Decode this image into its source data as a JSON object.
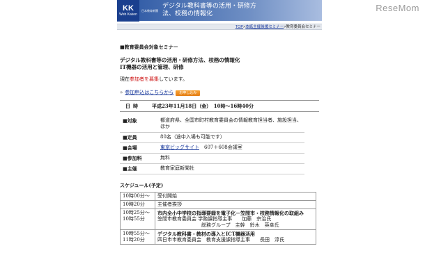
{
  "watermark": "ReseMom",
  "header": {
    "logo_main": "KK",
    "logo_sub": "Web Kaken",
    "publisher": "日本教育新聞",
    "banner_line1": "デジタル教科書等の活用・研修方",
    "banner_line2": "法、校務の情報化"
  },
  "breadcrumb": {
    "items": [
      "TOP",
      "本紙主催後援セミナー",
      "教育委員会セミナー"
    ],
    "separator": ">"
  },
  "seminar": {
    "category": "■教育委員会対象セミナー",
    "title_line1": "デジタル教科書等の活用・研修方法、校務の情報化",
    "title_line2": "IT機器の活用と管理、研修",
    "recruit_prefix": "現在",
    "recruit_highlight": "参加者を募集",
    "recruit_suffix": "しています。",
    "apply_arrow": "»",
    "apply_link": "参加申込はこちらから",
    "apply_button": "お申し込み",
    "date_label": "日時",
    "date_value": "平成23年11月18日（金）　10時〜16時40分"
  },
  "info": [
    {
      "key": "■対象",
      "value": "都道府県、全国市町村教育委員会の情報教育担当者、施設担当、ほか"
    },
    {
      "key": "■定員",
      "value": "80名（途中入場も可能です）"
    },
    {
      "key": "■会場",
      "link": "東京ビッグサイト",
      "value": "607＋608会議室"
    },
    {
      "key": "■参加料",
      "value": "無料"
    },
    {
      "key": "■主催",
      "value": "教育家庭新聞社"
    }
  ],
  "schedule": {
    "label": "スケジュール(予定)",
    "rows": [
      {
        "time": "10時00分〜",
        "bold": false,
        "title": "",
        "lines": [
          "受付開始"
        ]
      },
      {
        "time": "10時20分",
        "bold": false,
        "title": "",
        "lines": [
          "主催者挨拶"
        ]
      },
      {
        "time": "10時25分〜\n10時55分",
        "bold": true,
        "title": "市内全小中学校の指導要録を電子化－笠間市・校務情報化の取組み",
        "lines": [
          "笠間市教育委員会 学務課指導主事　　加藤　宗治氏",
          "　　　　　　　　　総務グループ　主幹　鈴木　英幸氏"
        ]
      },
      {
        "time": "10時55分〜\n11時20分",
        "bold": false,
        "title": "デジタル教科書・教材の導入とICT機器活用",
        "lines": [
          "四日市市教育委員会　教育支援課指導主事　　長田　淳氏"
        ]
      }
    ]
  }
}
